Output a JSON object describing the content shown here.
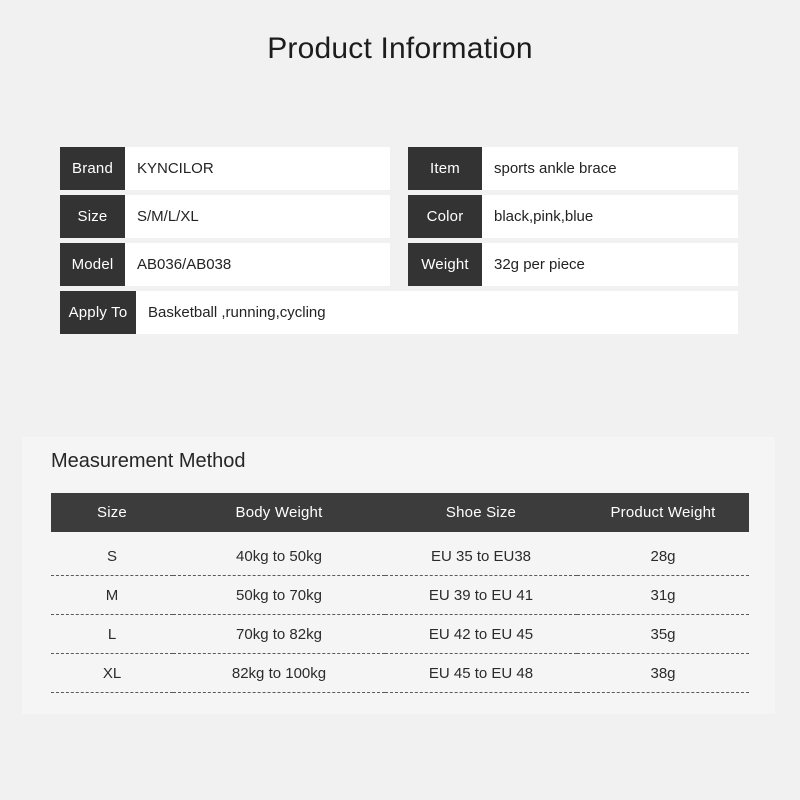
{
  "page": {
    "title": "Product Information",
    "background_color": "#f1f1f1",
    "label_color": "#333333",
    "header_bar_color": "#3c3c3c"
  },
  "spec_rows": [
    {
      "left": {
        "label": "Brand",
        "value": "KYNCILOR"
      },
      "right": {
        "label": "Item",
        "value": "sports ankle brace"
      }
    },
    {
      "left": {
        "label": "Size",
        "value": "S/M/L/XL"
      },
      "right": {
        "label": "Color",
        "value": "black,pink,blue"
      }
    },
    {
      "left": {
        "label": "Model",
        "value": "AB036/AB038"
      },
      "right": {
        "label": "Weight",
        "value": "32g per piece"
      }
    }
  ],
  "spec_full_row": {
    "label": "Apply To",
    "value": "Basketball ,running,cycling"
  },
  "measurement": {
    "title": "Measurement Method",
    "columns": [
      "Size",
      "Body Weight",
      "Shoe Size",
      "Product Weight"
    ],
    "rows": [
      {
        "size": "S",
        "body_weight": "40kg to 50kg",
        "shoe_size": "EU 35 to EU38",
        "product_weight": "28g"
      },
      {
        "size": "M",
        "body_weight": "50kg to 70kg",
        "shoe_size": "EU 39 to EU 41",
        "product_weight": "31g"
      },
      {
        "size": "L",
        "body_weight": "70kg to 82kg",
        "shoe_size": "EU 42 to EU 45",
        "product_weight": "35g"
      },
      {
        "size": "XL",
        "body_weight": "82kg to 100kg",
        "shoe_size": "EU 45 to EU 48",
        "product_weight": "38g"
      }
    ]
  }
}
